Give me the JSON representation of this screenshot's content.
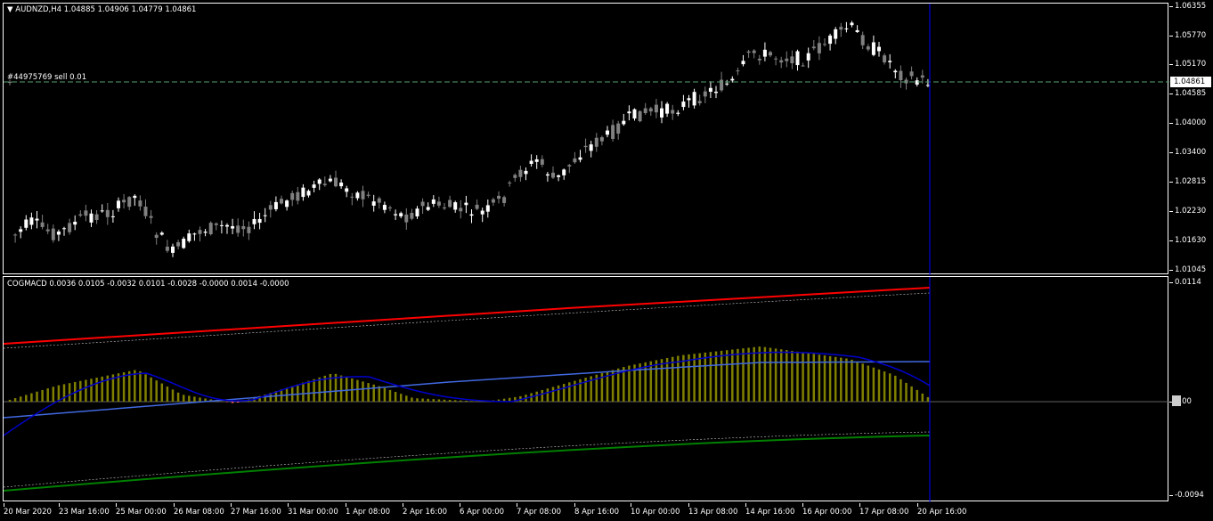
{
  "chart": {
    "header": "AUDNZD,H4  1.04885 1.04906 1.04779 1.04861",
    "order_label": "#44975769 sell 0.01",
    "current_price": "1.04861",
    "price_ticks": [
      "1.06355",
      "1.05770",
      "1.05170",
      "1.04585",
      "1.04000",
      "1.03400",
      "1.02815",
      "1.02230",
      "1.01630",
      "1.01045"
    ],
    "colors": {
      "bull": "#ffffff",
      "bear": "#808080",
      "order_line": "#5a9c6e",
      "vline": "#0000ff"
    }
  },
  "indicator": {
    "header": "COGMACD 0.0036 0.0105 -0.0032 0.0101 -0.0028 -0.0000 0.0014 -0.0000",
    "ticks": [
      "0.0114",
      "0.00",
      "-0.0094"
    ],
    "colors": {
      "hist": "#808000",
      "upper": "#ff0000",
      "lower": "#008000",
      "signal": "#4169e1",
      "macd": "#0000cd"
    }
  },
  "time_axis": [
    "20 Mar 2020",
    "23 Mar 16:00",
    "25 Mar 00:00",
    "26 Mar 08:00",
    "27 Mar 16:00",
    "31 Mar 00:00",
    "1 Apr 08:00",
    "2 Apr 16:00",
    "6 Apr 00:00",
    "7 Apr 08:00",
    "8 Apr 16:00",
    "10 Apr 00:00",
    "13 Apr 08:00",
    "14 Apr 16:00",
    "16 Apr 00:00",
    "17 Apr 08:00",
    "20 Apr 16:00"
  ]
}
